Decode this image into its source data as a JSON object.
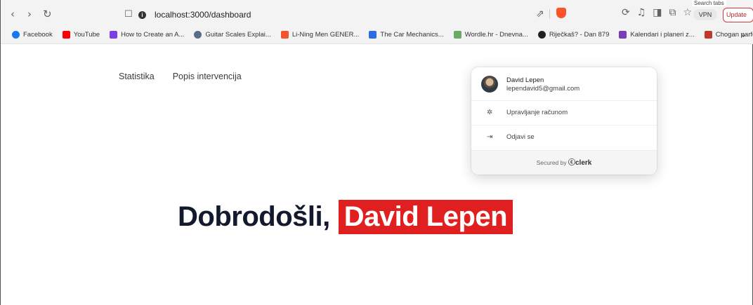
{
  "browser": {
    "url": "localhost:3000/dashboard",
    "vpn_label": "VPN",
    "update_label": "Update",
    "tooltip": "Search tabs",
    "bookmarks": [
      {
        "label": "Facebook",
        "color": "#1877f2"
      },
      {
        "label": "YouTube",
        "color": "#ff0000"
      },
      {
        "label": "How to Create an A...",
        "color": "#7b3fe4"
      },
      {
        "label": "Guitar Scales Explai...",
        "color": "#5a6d85"
      },
      {
        "label": "Li-Ning Men GENER...",
        "color": "#f2542d"
      },
      {
        "label": "The Car Mechanics...",
        "color": "#2d6cdf"
      },
      {
        "label": "Wordle.hr - Dnevna...",
        "color": "#6aaa64"
      },
      {
        "label": "Riječkaš? - Dan 879",
        "color": "#222222"
      },
      {
        "label": "Kalendari i planeri z...",
        "color": "#7a3db8"
      },
      {
        "label": "Chogan parfemi za...",
        "color": "#c0392b"
      }
    ]
  },
  "nav": {
    "items": [
      "Statistika",
      "Popis intervencija"
    ]
  },
  "user_menu": {
    "name": "David Lepen",
    "email": "lependavid5@gmail.com",
    "manage_account": "Upravljanje računom",
    "sign_out": "Odjavi se",
    "secured_by": "Secured by",
    "brand": "clerk"
  },
  "hero": {
    "greeting": "Dobrodošli,",
    "name": "David Lepen",
    "accent_color": "#e02020"
  }
}
